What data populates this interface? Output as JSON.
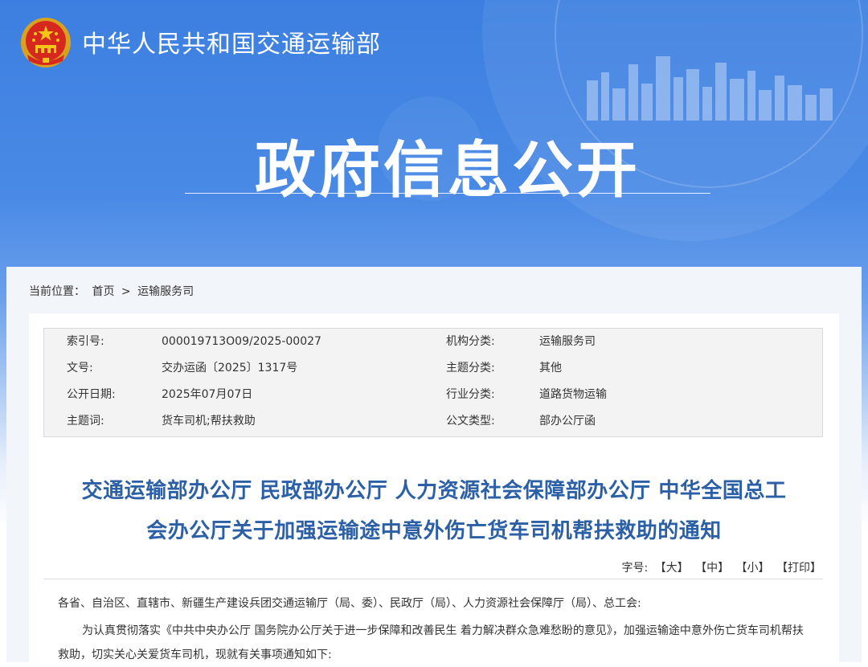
{
  "header": {
    "ministry_name": "中华人民共和国交通运输部",
    "hero_title": "政府信息公开"
  },
  "breadcrumb": {
    "prefix": "当前位置：",
    "home": "首页",
    "separator": ">",
    "current": "运输服务司"
  },
  "meta": {
    "rows": [
      {
        "k1": "索引号:",
        "v1": "000019713O09/2025-00027",
        "k2": "机构分类:",
        "v2": "运输服务司"
      },
      {
        "k1": "文号:",
        "v1": "交办运函〔2025〕1317号",
        "k2": "主题分类:",
        "v2": "其他"
      },
      {
        "k1": "公开日期:",
        "v1": "2025年07月07日",
        "k2": "行业分类:",
        "v2": "道路货物运输"
      },
      {
        "k1": "主题词:",
        "v1": "货车司机;帮扶救助",
        "k2": "公文类型:",
        "v2": "部办公厅函"
      }
    ]
  },
  "document": {
    "title_line1": "交通运输部办公厅 民政部办公厅 人力资源社会保障部办公厅 中华全国总工",
    "title_line2": "会办公厅关于加强运输途中意外伤亡货车司机帮扶救助的通知",
    "font_size_label": "字号:",
    "font_large": "【大】",
    "font_medium": "【中】",
    "font_small": "【小】",
    "print": "【打印】",
    "para1": "各省、自治区、直辖市、新疆生产建设兵团交通运输厅（局、委）、民政厅（局）、人力资源社会保障厅（局）、总工会:",
    "para2": "为认真贯彻落实《中共中央办公厅 国务院办公厅关于进一步保障和改善民生 着力解决群众急难愁盼的意见》，加强运输途中意外伤亡货车司机帮扶救助，切实关心关爱货车司机，现就有关事项通知如下:"
  },
  "colors": {
    "banner_blue": "#3c7fe0",
    "title_blue": "#2b5fa6"
  },
  "icons": {
    "emblem": "national-emblem-icon",
    "skyline": "city-skyline-graphic"
  }
}
